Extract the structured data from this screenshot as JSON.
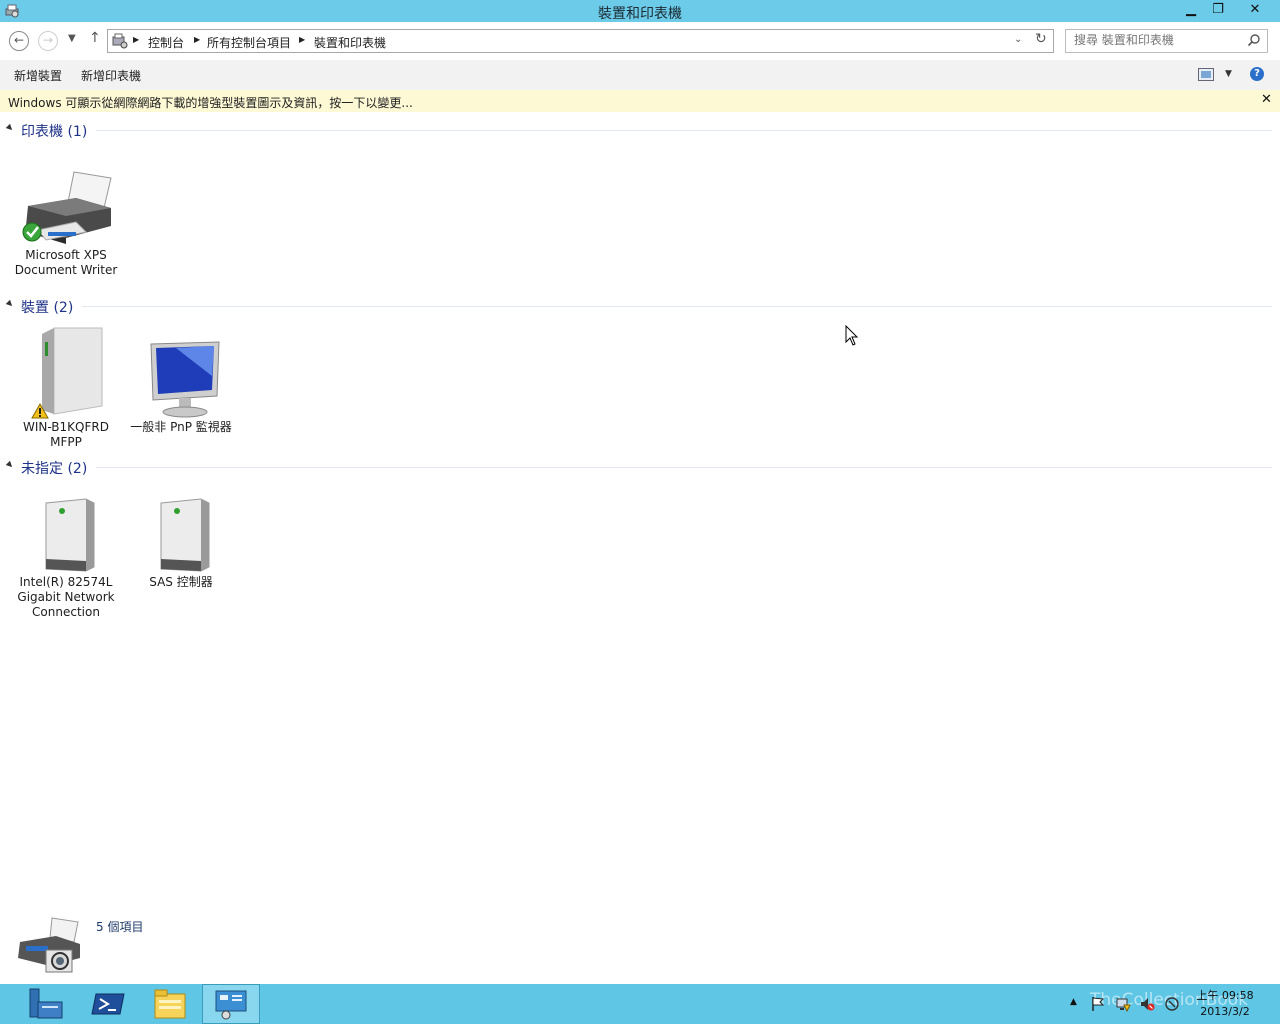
{
  "window": {
    "title": "裝置和印表機",
    "buttons": {
      "minimize": "▁",
      "maximize": "❐",
      "close": "✕"
    }
  },
  "addressbar": {
    "back_icon": "←",
    "forward_icon": "→",
    "up_icon": "↑",
    "crumbs": [
      "控制台",
      "所有控制台項目",
      "裝置和印表機"
    ],
    "dropdown": "⌄",
    "refresh": "↻"
  },
  "search": {
    "placeholder": "搜尋 裝置和印表機"
  },
  "commandbar": {
    "add_device": "新增裝置",
    "add_printer": "新增印表機"
  },
  "infobar": {
    "text": "Windows 可顯示從網際網路下載的增強型裝置圖示及資訊，按一下以變更...",
    "close": "✕"
  },
  "groups": [
    {
      "title": "印表機 (1)",
      "items": [
        {
          "label": "Microsoft XPS Document Writer",
          "icon": "printer-icon",
          "status": "default"
        }
      ]
    },
    {
      "title": "裝置 (2)",
      "items": [
        {
          "label": "WIN-B1KQFRD MFPP",
          "icon": "computer-tower-icon",
          "status": "warning"
        },
        {
          "label": "一般非 PnP 監視器",
          "icon": "monitor-icon"
        }
      ]
    },
    {
      "title": "未指定 (2)",
      "items": [
        {
          "label": "Intel(R) 82574L Gigabit Network Connection",
          "icon": "generic-device-icon"
        },
        {
          "label": "SAS 控制器",
          "icon": "generic-device-icon"
        }
      ]
    }
  ],
  "details": {
    "count_text": "5 個項目"
  },
  "taskbar": {
    "apps": [
      "server-manager-icon",
      "powershell-icon",
      "file-explorer-icon",
      "control-panel-icon"
    ],
    "clock": {
      "time": "上午 09:58",
      "date": "2013/3/2"
    },
    "watermark": "TheCollectionBook"
  },
  "colors": {
    "titlebar": "#6ccbe8",
    "taskbar": "#5fc6e5",
    "infobar": "#fdf9d5",
    "group_title": "#1e3287"
  }
}
